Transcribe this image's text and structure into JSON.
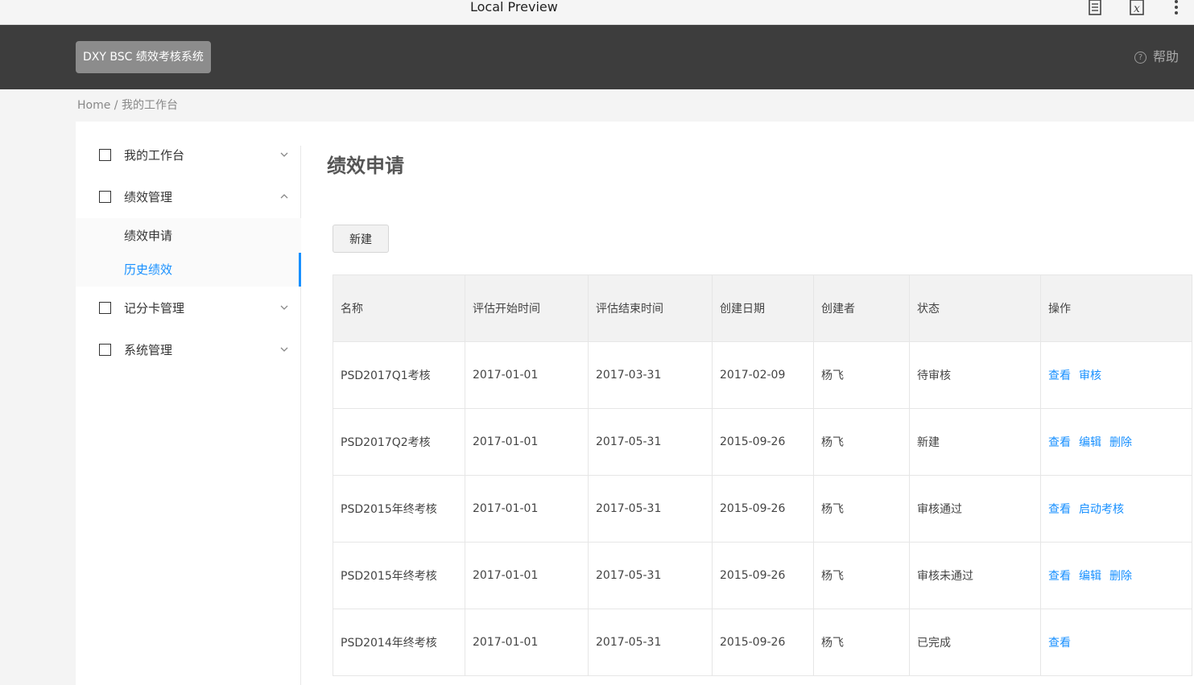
{
  "preview": {
    "title": "Local Preview",
    "icons": [
      "document-icon",
      "formula-icon",
      "more-vertical-icon"
    ]
  },
  "header": {
    "logo_text": "DXY BSC 绩效考核系统",
    "help_label": "帮助",
    "help_icon_glyph": "?"
  },
  "breadcrumb": {
    "text": "Home / 我的工作台"
  },
  "sidebar": {
    "items": [
      {
        "label": "我的工作台",
        "expanded": false
      },
      {
        "label": "绩效管理",
        "expanded": true,
        "children": [
          "绩效申请",
          "历史绩效"
        ],
        "active_child": "历史绩效"
      },
      {
        "label": "记分卡管理",
        "expanded": false
      },
      {
        "label": "系统管理",
        "expanded": false
      }
    ]
  },
  "main": {
    "title": "绩效申请",
    "new_button": "新建",
    "table": {
      "columns": [
        "名称",
        "评估开始时间",
        "评估结束时间",
        "创建日期",
        "创建者",
        "状态",
        "操作"
      ],
      "rows": [
        {
          "name": "PSD2017Q1考核",
          "start": "2017-01-01",
          "end": "2017-03-31",
          "created": "2017-02-09",
          "creator": "杨飞",
          "status": "待审核",
          "actions": [
            "查看",
            "审核"
          ]
        },
        {
          "name": "PSD2017Q2考核",
          "start": "2017-01-01",
          "end": "2017-05-31",
          "created": "2015-09-26",
          "creator": "杨飞",
          "status": "新建",
          "actions": [
            "查看",
            "编辑",
            "删除"
          ]
        },
        {
          "name": "PSD2015年终考核",
          "start": "2017-01-01",
          "end": "2017-05-31",
          "created": "2015-09-26",
          "creator": "杨飞",
          "status": "审核通过",
          "actions": [
            "查看",
            "启动考核"
          ]
        },
        {
          "name": "PSD2015年终考核",
          "start": "2017-01-01",
          "end": "2017-05-31",
          "created": "2015-09-26",
          "creator": "杨飞",
          "status": "审核未通过",
          "actions": [
            "查看",
            "编辑",
            "删除"
          ]
        },
        {
          "name": "PSD2014年终考核",
          "start": "2017-01-01",
          "end": "2017-05-31",
          "created": "2015-09-26",
          "creator": "杨飞",
          "status": "已完成",
          "actions": [
            "查看"
          ]
        }
      ]
    }
  },
  "colors": {
    "header_bg": "#3d3d3d",
    "accent": "#1890ff",
    "logo_bg": "#8c8c8c"
  }
}
